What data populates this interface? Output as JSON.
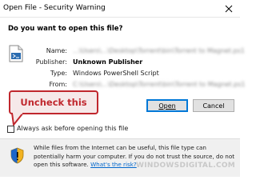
{
  "window": {
    "title": "Open File - Security Warning",
    "close_icon": "close-icon"
  },
  "dialog": {
    "question": "Do you want to open this file?",
    "file_icon": "script-file-icon",
    "fields": {
      "name_label": "Name:",
      "name_value": "...\\Users\\...\\Desktop\\Torrent\\bin\\Torrent to Magnet.ps1",
      "publisher_label": "Publisher:",
      "publisher_value": "Unknown Publisher",
      "type_label": "Type:",
      "type_value": "Windows PowerShell Script",
      "from_label": "From:",
      "from_value": "C:\\Users\\...\\Desktop\\Torrent\\bin\\Torrent to Magnet.ps1"
    },
    "buttons": {
      "open_label": "Open",
      "cancel_label": "Cancel"
    },
    "callout_text": "Uncheck this",
    "checkbox": {
      "checked": false,
      "label": "Always ask before opening this file"
    }
  },
  "footer": {
    "shield_icon": "security-shield-icon",
    "warning_text": "While files from the Internet can be useful, this file type can potentially harm your computer. If you do not trust the source, do not open this software.",
    "link_text": "What's the risk?"
  },
  "watermark": "WINDOWSDIGITAL.COM",
  "colors": {
    "accent": "#0078d7",
    "callout_red": "#c0272d",
    "callout_fill": "#f6e9e9",
    "link": "#0066cc",
    "footer_bg": "#f0f0f0"
  }
}
